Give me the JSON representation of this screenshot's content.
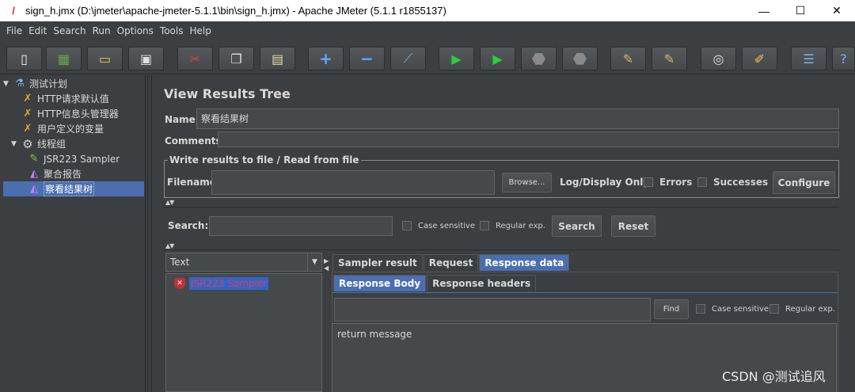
{
  "window": {
    "title": "sign_h.jmx (D:\\jmeter\\apache-jmeter-5.1.1\\bin\\sign_h.jmx) - Apache JMeter (5.1.1 r1855137)",
    "minimize": "—",
    "maximize": "☐",
    "close": "✕"
  },
  "menu": [
    "File",
    "Edit",
    "Search",
    "Run",
    "Options",
    "Tools",
    "Help"
  ],
  "toolbar": [
    {
      "name": "new",
      "glyph": "▯"
    },
    {
      "name": "templates",
      "glyph": "▦"
    },
    {
      "name": "open",
      "glyph": "▭"
    },
    {
      "name": "save",
      "glyph": "▣"
    },
    {
      "name": "cut",
      "glyph": "✂"
    },
    {
      "name": "copy",
      "glyph": "❐"
    },
    {
      "name": "paste",
      "glyph": "▤"
    },
    {
      "name": "expand",
      "glyph": "+"
    },
    {
      "name": "collapse",
      "glyph": "−"
    },
    {
      "name": "toggle",
      "glyph": "⟋"
    },
    {
      "name": "start",
      "glyph": "▶"
    },
    {
      "name": "start-no-pause",
      "glyph": "▶"
    },
    {
      "name": "stop",
      "glyph": "⬣"
    },
    {
      "name": "shutdown",
      "glyph": "⬣"
    },
    {
      "name": "clear",
      "glyph": "✎"
    },
    {
      "name": "clear-all",
      "glyph": "✎"
    },
    {
      "name": "search",
      "glyph": "◎"
    },
    {
      "name": "reset-search",
      "glyph": "✐"
    },
    {
      "name": "function-helper",
      "glyph": "☰"
    },
    {
      "name": "help",
      "glyph": "?"
    }
  ],
  "tree": [
    {
      "label": "测试计划",
      "toggle": "▼",
      "icon": "flask-icon",
      "glyph": "⚗",
      "depth": 0
    },
    {
      "label": "HTTP请求默认值",
      "toggle": "",
      "icon": "config-icon",
      "glyph": "✗",
      "depth": 1
    },
    {
      "label": "HTTP信息头管理器",
      "toggle": "",
      "icon": "config-icon",
      "glyph": "✗",
      "depth": 1
    },
    {
      "label": "用户定义的变量",
      "toggle": "",
      "icon": "config-icon",
      "glyph": "✗",
      "depth": 1
    },
    {
      "label": "线程组",
      "toggle": "▼",
      "icon": "gear-icon",
      "glyph": "⚙",
      "depth": 1
    },
    {
      "label": "JSR223 Sampler",
      "toggle": "",
      "icon": "pencil-icon",
      "glyph": "✎",
      "depth": 2
    },
    {
      "label": "聚合报告",
      "toggle": "",
      "icon": "chart-icon",
      "glyph": "◭",
      "depth": 2
    },
    {
      "label": "察看结果树",
      "toggle": "",
      "icon": "chart-icon",
      "glyph": "◭",
      "depth": 2,
      "selected": true
    }
  ],
  "panel": {
    "title": "View Results Tree",
    "name_label": "Name:",
    "name_value": "察看结果树",
    "comments_label": "Comments:",
    "file_group_label": "Write results to file / Read from file",
    "filename_label": "Filename",
    "browse": "Browse...",
    "log_display": "Log/Display Only:",
    "errors": "Errors",
    "successes": "Successes",
    "configure": "Configure",
    "search_label": "Search:",
    "case_sensitive": "Case sensitive",
    "regex": "Regular exp.",
    "search_btn": "Search",
    "reset_btn": "Reset",
    "renderer": "Text",
    "result_item": "JSR223 Sampler",
    "tabs": [
      "Sampler result",
      "Request",
      "Response data"
    ],
    "subtabs": [
      "Response Body",
      "Response headers"
    ],
    "find_btn": "Find",
    "find_case": "Case sensitive",
    "find_regex": "Regular exp.",
    "response_text": "return message"
  },
  "watermark": "CSDN @测试追风"
}
